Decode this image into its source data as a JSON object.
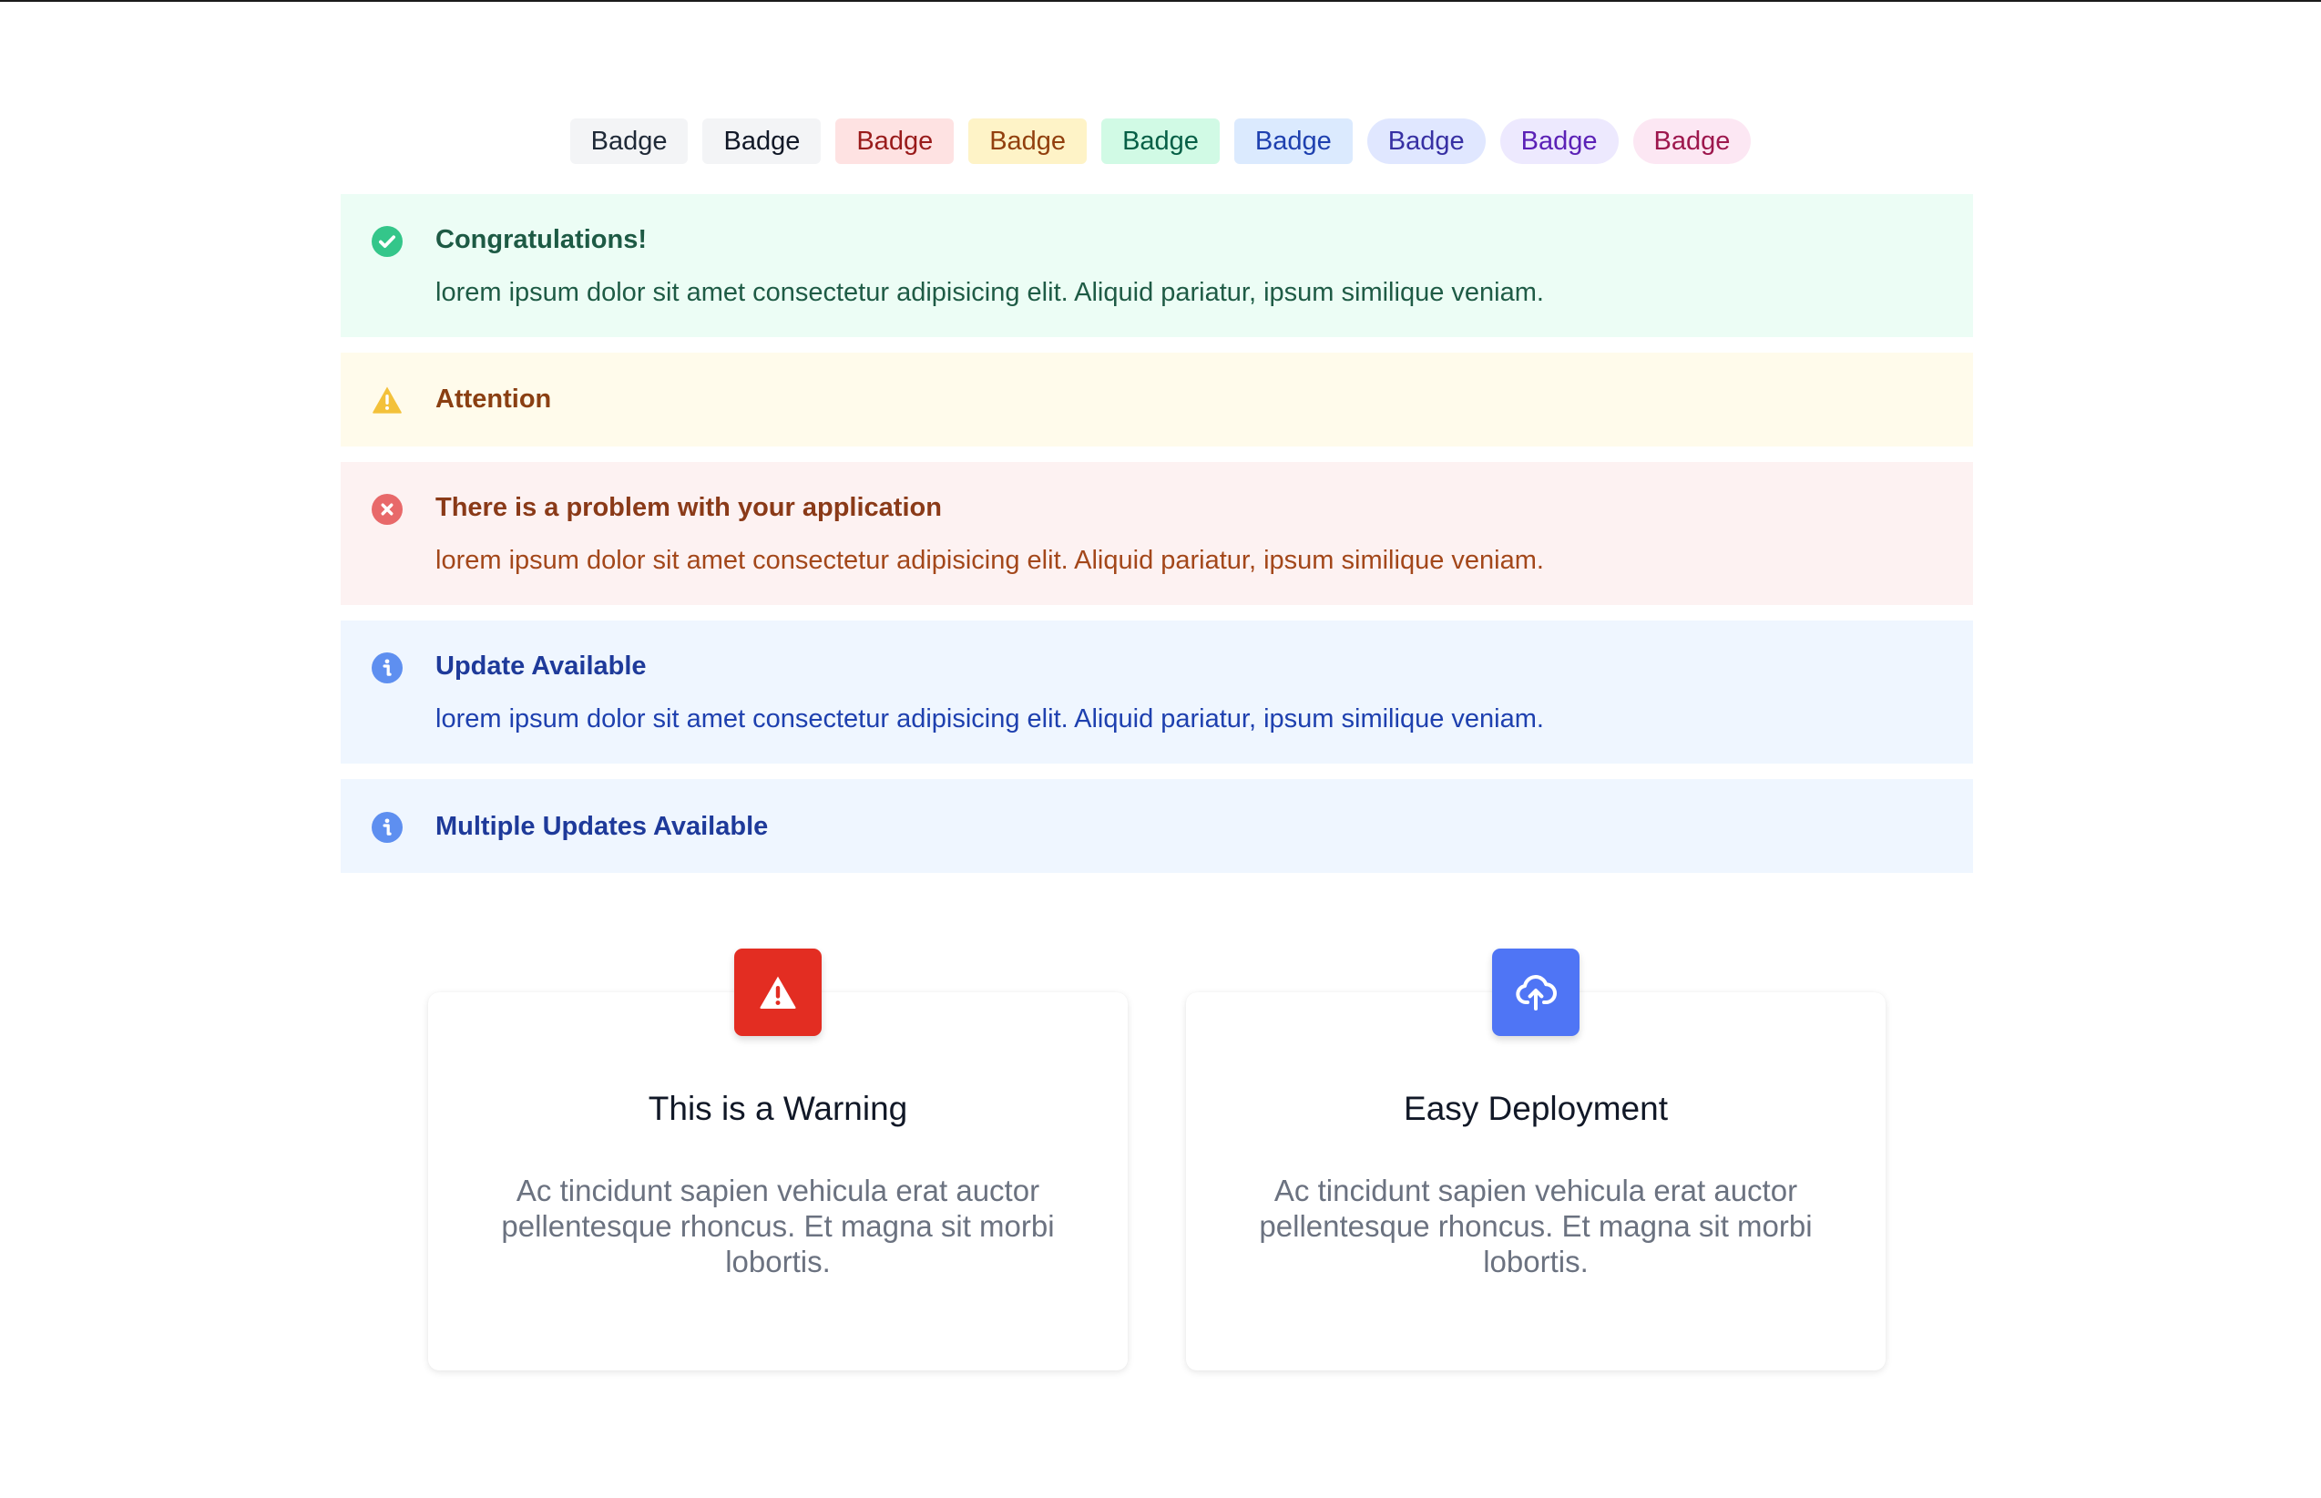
{
  "badges": [
    {
      "label": "Badge",
      "style": "gray",
      "shape": "rounded"
    },
    {
      "label": "Badge",
      "style": "gray",
      "shape": "rounded"
    },
    {
      "label": "Badge",
      "style": "red",
      "shape": "rounded"
    },
    {
      "label": "Badge",
      "style": "yellow",
      "shape": "rounded"
    },
    {
      "label": "Badge",
      "style": "green",
      "shape": "rounded"
    },
    {
      "label": "Badge",
      "style": "blue",
      "shape": "rounded"
    },
    {
      "label": "Badge",
      "style": "indigo",
      "shape": "pill"
    },
    {
      "label": "Badge",
      "style": "purple",
      "shape": "pill"
    },
    {
      "label": "Badge",
      "style": "pink",
      "shape": "pill"
    }
  ],
  "alerts": {
    "success": {
      "icon": "check-circle-icon",
      "title": "Congratulations!",
      "body": "lorem ipsum dolor sit amet consectetur adipisicing elit. Aliquid pariatur, ipsum similique veniam."
    },
    "warning": {
      "icon": "warning-triangle-icon",
      "title": "Attention"
    },
    "error": {
      "icon": "x-circle-icon",
      "title": "There is a problem with your application",
      "body": "lorem ipsum dolor sit amet consectetur adipisicing elit. Aliquid pariatur, ipsum similique veniam."
    },
    "info": {
      "icon": "info-circle-icon",
      "title": "Update Available",
      "body": "lorem ipsum dolor sit amet consectetur adipisicing elit. Aliquid pariatur, ipsum similique veniam."
    },
    "info_multiple": {
      "icon": "info-circle-icon",
      "title": "Multiple Updates Available"
    }
  },
  "cards": [
    {
      "icon": "warning-triangle-icon",
      "icon_color": "#e32d22",
      "title": "This is a Warning",
      "text": "Ac tincidunt sapien vehicula erat auctor pellentesque rhoncus. Et magna sit morbi lobortis."
    },
    {
      "icon": "cloud-upload-icon",
      "icon_color": "#4f75f5",
      "title": "Easy Deployment",
      "text": "Ac tincidunt sapien vehicula erat auctor pellentesque rhoncus. Et magna sit morbi lobortis."
    }
  ],
  "colors": {
    "success_icon": "#34c68a",
    "warning_icon": "#f3c13a",
    "error_icon": "#e8696a",
    "info_icon": "#5e8ff0"
  }
}
